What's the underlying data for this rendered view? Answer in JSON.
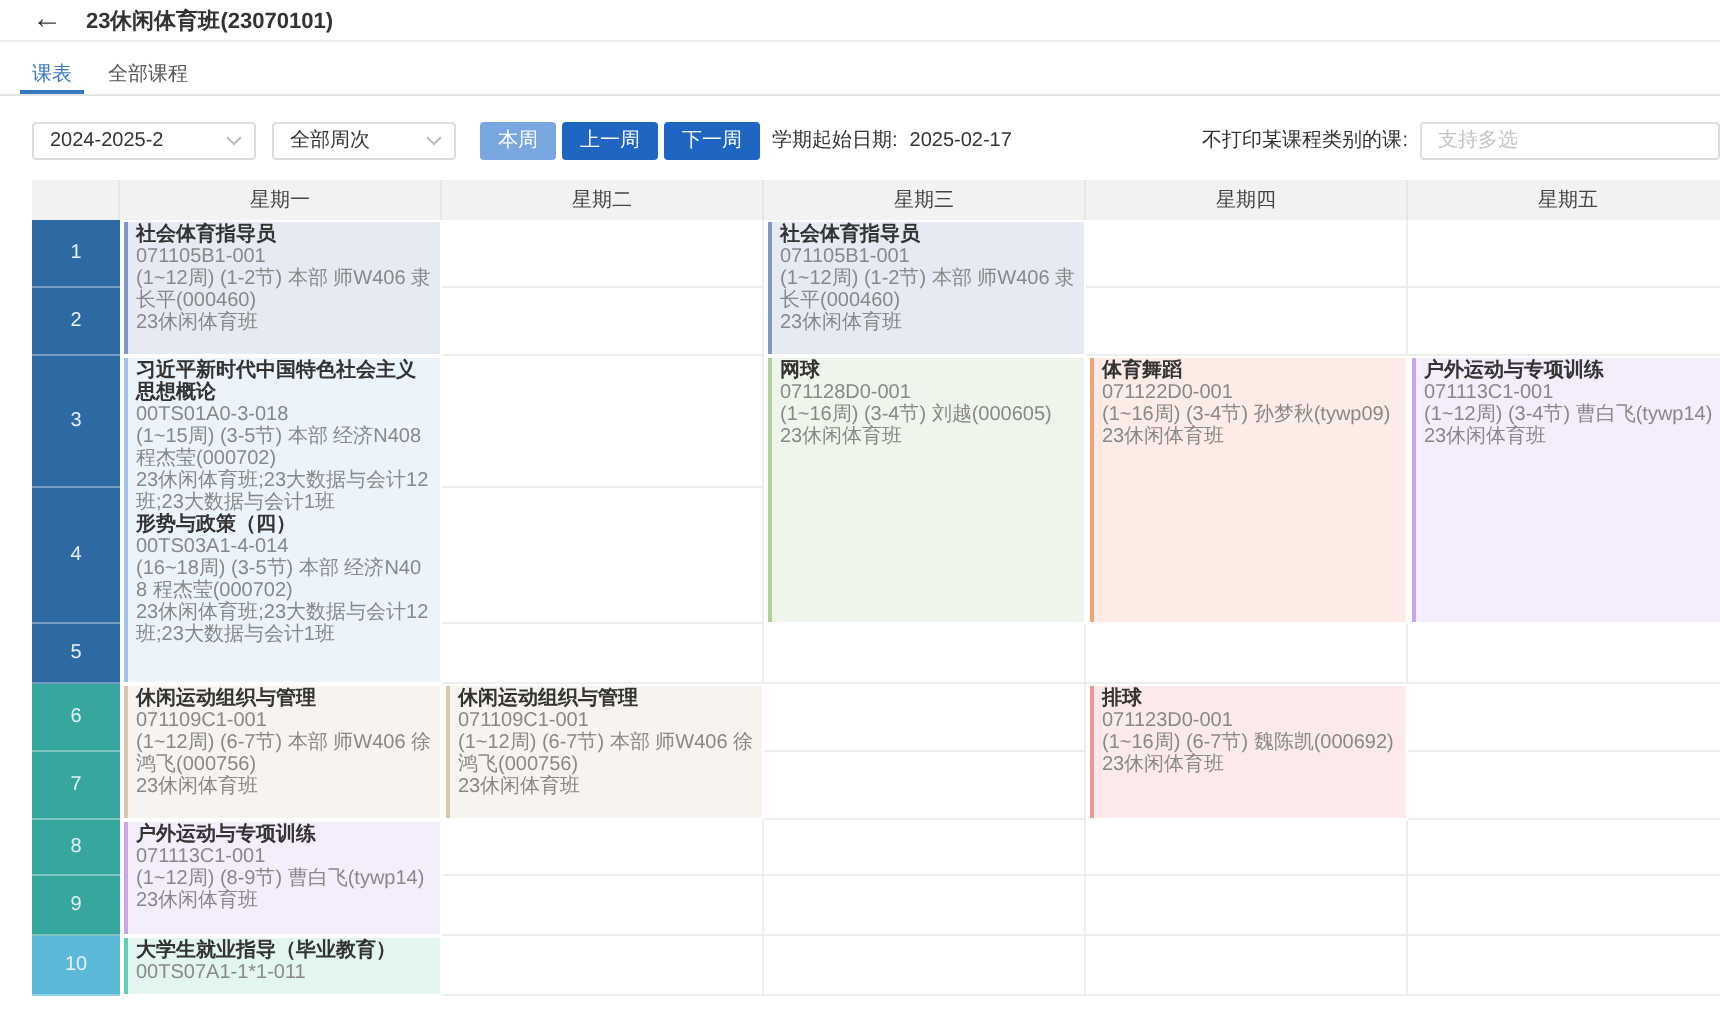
{
  "header": {
    "back_icon": "←",
    "title": "23休闲体育班(23070101)"
  },
  "tabs": [
    {
      "label": "课表",
      "selected": true
    },
    {
      "label": "全部课程",
      "selected": false
    }
  ],
  "toolbar": {
    "term": "2024-2025-2",
    "weeks": "全部周次",
    "buttons": [
      {
        "label": "本周",
        "disabled": true
      },
      {
        "label": "上一周",
        "disabled": false
      },
      {
        "label": "下一周",
        "disabled": false
      }
    ],
    "start_date_label": "学期起始日期:",
    "start_date": "2025-02-17",
    "exclude_label": "不打印某课程类别的课:",
    "exclude_placeholder": "支持多选"
  },
  "periods": [
    {
      "label": "1",
      "color": "#2d6aa4"
    },
    {
      "label": "2",
      "color": "#2d6aa4"
    },
    {
      "label": "3",
      "color": "#2d6aa4"
    },
    {
      "label": "4",
      "color": "#2d6aa4"
    },
    {
      "label": "5",
      "color": "#2d6aa4"
    },
    {
      "label": "6",
      "color": "#36a79c"
    },
    {
      "label": "7",
      "color": "#36a79c"
    },
    {
      "label": "8",
      "color": "#36a79c"
    },
    {
      "label": "9",
      "color": "#36a79c"
    },
    {
      "label": "10",
      "color": "#5bb8d6"
    }
  ],
  "days": [
    {
      "name": "星期一",
      "slots": [
        {
          "kind": "start",
          "color": "#8395c4",
          "entries": [
            {
              "title": "社会体育指导员",
              "code": "071105B1-001",
              "detail": "(1~12周) (1-2节) 本部 师W406  隶长平(000460)",
              "classes": "23休闲体育班"
            }
          ]
        },
        {
          "kind": "cont"
        },
        {
          "kind": "start",
          "color": "#9cc2ea",
          "entries": [
            {
              "title": "习近平新时代中国特色社会主义思想概论",
              "code": "00TS01A0-3-018",
              "detail": "(1~15周) (3-5节) 本部 经济N408  程杰莹(000702)",
              "classes": "23休闲体育班;23大数据与会计12班;23大数据与会计1班"
            },
            {
              "title": "形势与政策（四）",
              "code": "00TS03A1-4-014",
              "detail": "(16~18周) (3-5节) 本部 经济N408  程杰莹(000702)",
              "classes": "23休闲体育班;23大数据与会计12班;23大数据与会计1班"
            }
          ]
        },
        {
          "kind": "cont"
        },
        {
          "kind": "cont"
        },
        {
          "kind": "start",
          "color": "#d6c6ae",
          "entries": [
            {
              "title": "休闲运动组织与管理",
              "code": "071109C1-001",
              "detail": "(1~12周) (6-7节) 本部 师W406  徐鸿飞(000756)",
              "classes": "23休闲体育班"
            }
          ]
        },
        {
          "kind": "cont"
        },
        {
          "kind": "start",
          "color": "#c7a6ea",
          "entries": [
            {
              "title": "户外运动与专项训练",
              "code": "071113C1-001",
              "detail": "(1~12周) (8-9节)  曹白飞(tywp14)",
              "classes": "23休闲体育班"
            }
          ]
        },
        {
          "kind": "cont"
        },
        {
          "kind": "start",
          "color": "#6ccbb8",
          "entries": [
            {
              "title": "大学生就业指导（毕业教育）",
              "code": "00TS07A1-1*1-011"
            }
          ]
        }
      ]
    },
    {
      "name": "星期二",
      "slots": [
        {
          "kind": "empty"
        },
        {
          "kind": "empty"
        },
        {
          "kind": "empty"
        },
        {
          "kind": "empty"
        },
        {
          "kind": "empty"
        },
        {
          "kind": "start",
          "color": "#d6c6ae",
          "entries": [
            {
              "title": "休闲运动组织与管理",
              "code": "071109C1-001",
              "detail": "(1~12周) (6-7节) 本部 师W406  徐鸿飞(000756)",
              "classes": "23休闲体育班"
            }
          ]
        },
        {
          "kind": "cont"
        },
        {
          "kind": "empty"
        },
        {
          "kind": "empty"
        },
        {
          "kind": "empty"
        }
      ]
    },
    {
      "name": "星期三",
      "slots": [
        {
          "kind": "start",
          "color": "#8395c4",
          "entries": [
            {
              "title": "社会体育指导员",
              "code": "071105B1-001",
              "detail": "(1~12周) (1-2节) 本部 师W406  隶长平(000460)",
              "classes": "23休闲体育班"
            }
          ]
        },
        {
          "kind": "cont"
        },
        {
          "kind": "start",
          "color": "#b3cd9c",
          "entries": [
            {
              "title": "网球",
              "code": "071128D0-001",
              "detail": "(1~16周) (3-4节)  刘越(000605)",
              "classes": "23休闲体育班"
            }
          ]
        },
        {
          "kind": "cont"
        },
        {
          "kind": "empty"
        },
        {
          "kind": "empty"
        },
        {
          "kind": "empty"
        },
        {
          "kind": "empty"
        },
        {
          "kind": "empty"
        },
        {
          "kind": "empty"
        }
      ]
    },
    {
      "name": "星期四",
      "slots": [
        {
          "kind": "empty"
        },
        {
          "kind": "empty"
        },
        {
          "kind": "start",
          "color": "#f0a27c",
          "entries": [
            {
              "title": "体育舞蹈",
              "code": "071122D0-001",
              "detail": "(1~16周) (3-4节)  孙梦秋(tywp09)",
              "classes": "23休闲体育班"
            }
          ]
        },
        {
          "kind": "cont"
        },
        {
          "kind": "empty"
        },
        {
          "kind": "start",
          "color": "#ee9696",
          "entries": [
            {
              "title": "排球",
              "code": "071123D0-001",
              "detail": "(1~16周) (6-7节)  魏陈凯(000692)",
              "classes": "23休闲体育班"
            }
          ]
        },
        {
          "kind": "cont"
        },
        {
          "kind": "empty"
        },
        {
          "kind": "empty"
        },
        {
          "kind": "empty"
        }
      ]
    },
    {
      "name": "星期五",
      "slots": [
        {
          "kind": "empty"
        },
        {
          "kind": "empty"
        },
        {
          "kind": "start",
          "color": "#c7a6ea",
          "entries": [
            {
              "title": "户外运动与专项训练",
              "code": "071113C1-001",
              "detail": "(1~12周) (3-4节)  曹白飞(tywp14)",
              "classes": "23休闲体育班"
            }
          ]
        },
        {
          "kind": "cont"
        },
        {
          "kind": "empty"
        },
        {
          "kind": "empty"
        },
        {
          "kind": "empty"
        },
        {
          "kind": "empty"
        },
        {
          "kind": "empty"
        },
        {
          "kind": "empty"
        }
      ]
    }
  ]
}
